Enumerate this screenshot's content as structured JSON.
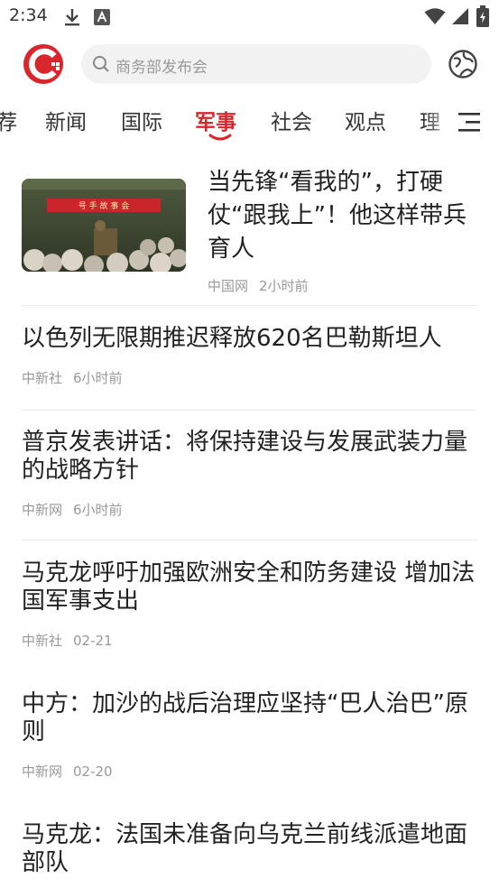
{
  "status": {
    "time": "2:34"
  },
  "search": {
    "placeholder": "商务部发布会"
  },
  "tabs": [
    {
      "label": "荐"
    },
    {
      "label": "新闻"
    },
    {
      "label": "国际"
    },
    {
      "label": "军事"
    },
    {
      "label": "社会"
    },
    {
      "label": "观点"
    },
    {
      "label": "理"
    }
  ],
  "thumbnail": {
    "banner_text": "号 手 故 事 会"
  },
  "lead": {
    "title": "当先锋“看我的”，打硬仗“跟我上”！他这样带兵育人",
    "source": "中国网",
    "time": "2小时前"
  },
  "news": [
    {
      "title": "以色列无限期推迟释放620名巴勒斯坦人",
      "source": "中新社",
      "time": "6小时前"
    },
    {
      "title": "普京发表讲话：将保持建设与发展武装力量的战略方针",
      "source": "中新网",
      "time": "6小时前"
    },
    {
      "title": "马克龙呼吁加强欧洲安全和防务建设 增加法国军事支出",
      "source": "中新社",
      "time": "02-21"
    },
    {
      "title": "中方：加沙的战后治理应坚持“巴人治巴”原则",
      "source": "中新网",
      "time": "02-20"
    },
    {
      "title": "马克龙：法国未准备向乌克兰前线派遣地面部队",
      "source": "",
      "time": ""
    }
  ],
  "colors": {
    "accent": "#d8262c",
    "meta": "#999999",
    "search_bg": "#f2f2f2"
  }
}
